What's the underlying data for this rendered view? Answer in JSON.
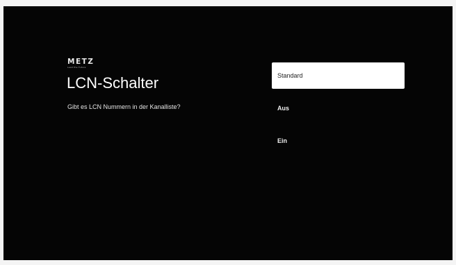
{
  "brand": {
    "name": "METZ",
    "tagline": "Lead the Future"
  },
  "page": {
    "title": "LCN-Schalter",
    "subtitle": "Gibt es LCN Nummern in der Kanalliste?"
  },
  "options": [
    {
      "label": "Standard",
      "selected": true
    },
    {
      "label": "Aus",
      "selected": false
    },
    {
      "label": "Ein",
      "selected": false
    }
  ]
}
